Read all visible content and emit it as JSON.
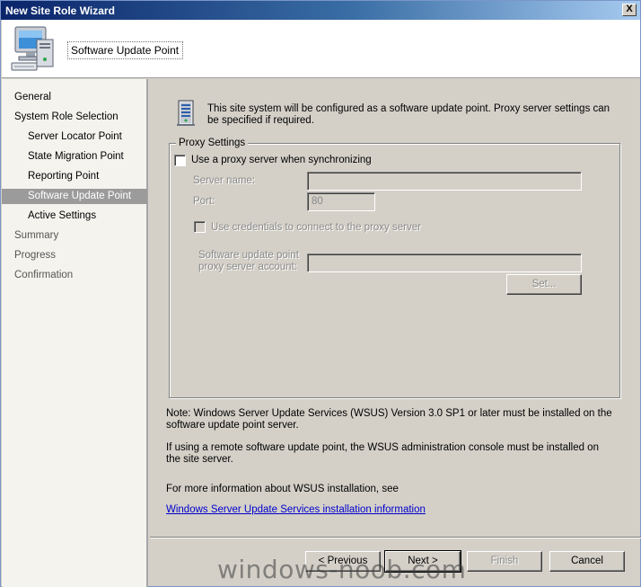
{
  "window": {
    "title": "New Site Role Wizard",
    "close_glyph": "X"
  },
  "header": {
    "title": "Software Update Point",
    "icon": "computer-icon"
  },
  "sidebar": {
    "items": [
      {
        "label": "General",
        "level": 1,
        "state": "done"
      },
      {
        "label": "System Role Selection",
        "level": 1,
        "state": "done"
      },
      {
        "label": "Server Locator Point",
        "level": 2,
        "state": "done"
      },
      {
        "label": "State Migration Point",
        "level": 2,
        "state": "done"
      },
      {
        "label": "Reporting Point",
        "level": 2,
        "state": "done"
      },
      {
        "label": "Software Update Point",
        "level": 2,
        "state": "selected"
      },
      {
        "label": "Active Settings",
        "level": 2,
        "state": "done"
      },
      {
        "label": "Summary",
        "level": 1,
        "state": "pending"
      },
      {
        "label": "Progress",
        "level": 1,
        "state": "pending"
      },
      {
        "label": "Confirmation",
        "level": 1,
        "state": "pending"
      }
    ]
  },
  "main": {
    "intro": "This site system will be configured as a software update point. Proxy server settings can be specified if required.",
    "intro_icon": "server-icon",
    "proxy": {
      "legend": "Proxy Settings",
      "use_proxy_label": "Use a proxy server when synchronizing",
      "use_proxy_checked": false,
      "server_name_label": "Server name:",
      "server_name_value": "",
      "port_label": "Port:",
      "port_value": "80",
      "use_credentials_label": "Use credentials to connect to the proxy server",
      "use_credentials_checked": false,
      "account_label_line1": "Software update point",
      "account_label_line2": "proxy server account:",
      "account_value": "",
      "set_button": "Set..."
    },
    "note1": "Note: Windows Server Update Services (WSUS) Version 3.0 SP1 or later must be installed on the software update point server.",
    "note2": "If using a remote software update point, the WSUS administration console must be installed on the site server.",
    "note3": "For more information about WSUS installation, see",
    "link": "Windows Server Update Services installation information"
  },
  "footer": {
    "previous": "< Previous",
    "next": "Next >",
    "finish": "Finish",
    "cancel": "Cancel"
  },
  "watermark": "windows-noob.com"
}
